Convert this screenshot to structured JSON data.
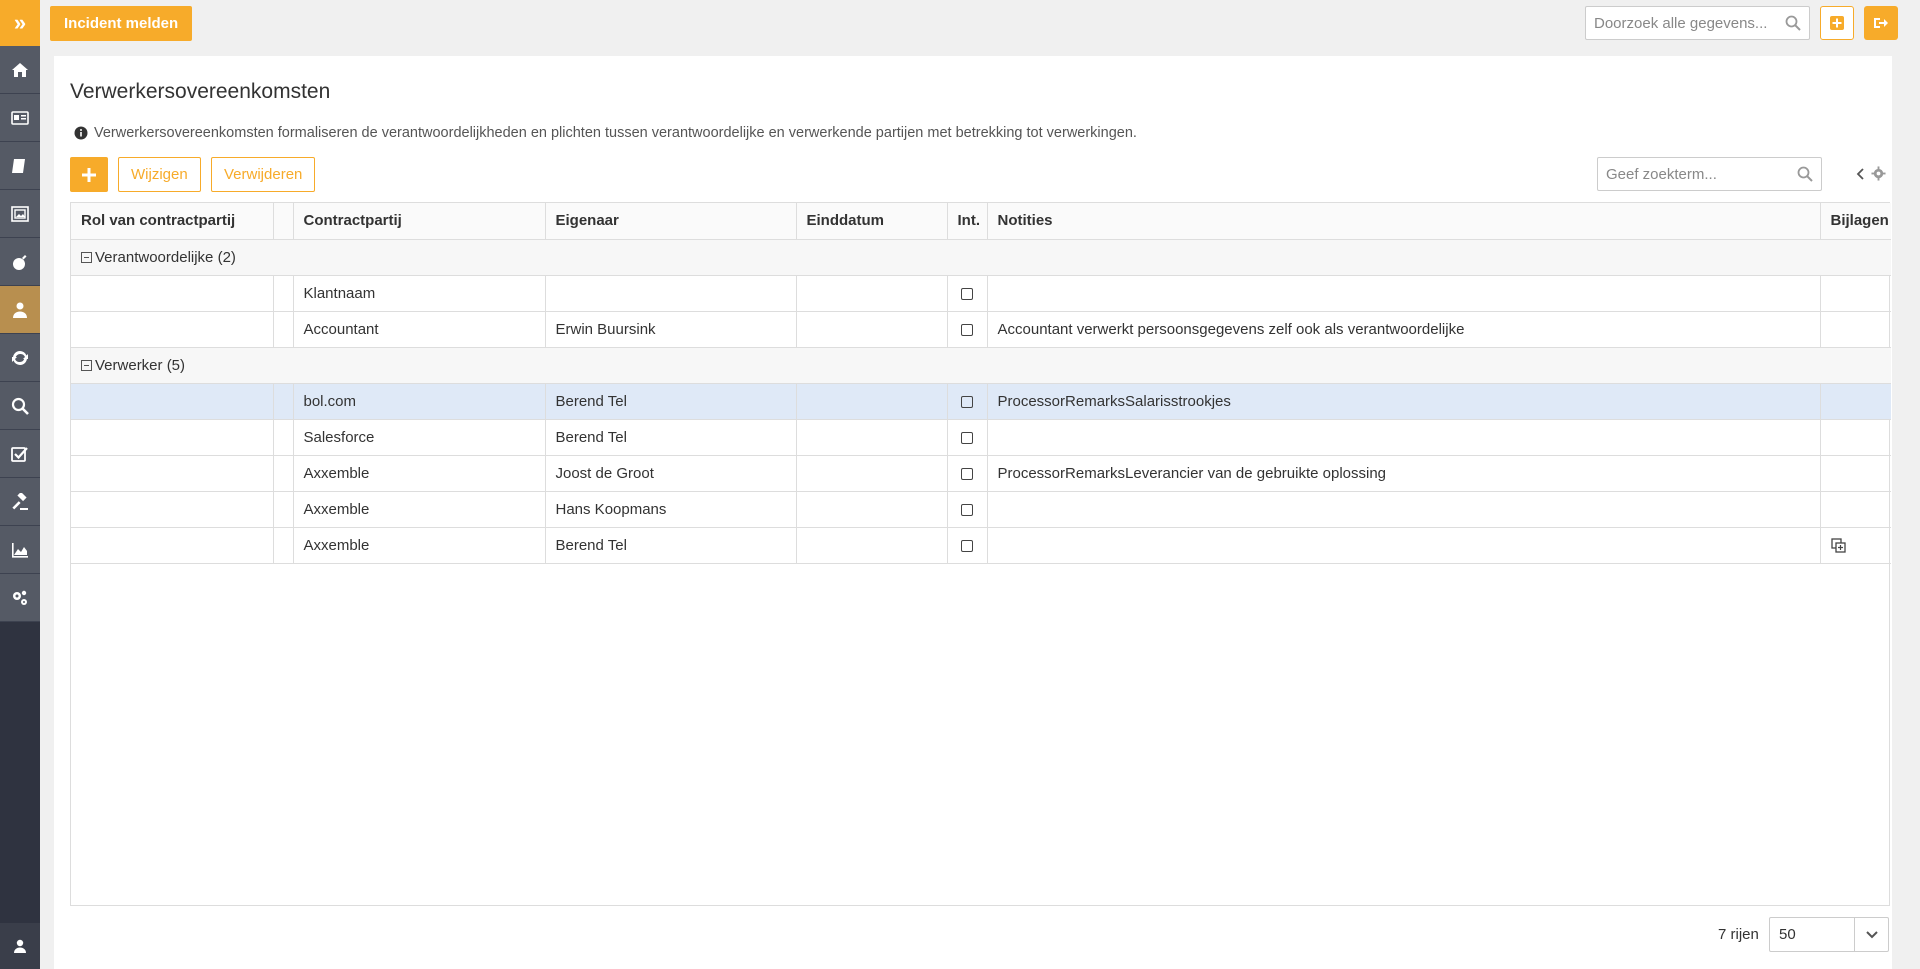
{
  "sidebar": {
    "toggle_glyph": "»",
    "items": [
      {
        "icon": "home-icon"
      },
      {
        "icon": "id-card-icon"
      },
      {
        "icon": "book-icon"
      },
      {
        "icon": "picture-frame-icon"
      },
      {
        "icon": "bomb-icon"
      },
      {
        "icon": "user-icon",
        "active": true
      },
      {
        "icon": "refresh-icon"
      },
      {
        "icon": "search-icon"
      },
      {
        "icon": "checkbox-icon"
      },
      {
        "icon": "gavel-icon"
      },
      {
        "icon": "area-chart-icon"
      },
      {
        "icon": "cogs-icon"
      }
    ],
    "bottom_icon": "user-icon"
  },
  "topbar": {
    "incident_label": "Incident melden",
    "search_placeholder": "Doorzoek alle gegevens..."
  },
  "page": {
    "title": "Verwerkersovereenkomsten",
    "info": "Verwerkersovereenkomsten formaliseren de verantwoordelijkheden en plichten tussen verantwoordelijke en verwerkende partijen met betrekking tot verwerkingen."
  },
  "toolbar": {
    "edit_label": "Wijzigen",
    "delete_label": "Verwijderen",
    "search_placeholder": "Geef zoekterm..."
  },
  "table": {
    "columns": [
      "Rol van contractpartij",
      "",
      "Contractpartij",
      "Eigenaar",
      "Einddatum",
      "Int.",
      "Notities",
      "Bijlagen"
    ],
    "groups": [
      {
        "label": "Verantwoordelijke (2)",
        "rows": [
          {
            "party": "Klantnaam",
            "owner": "",
            "end": "",
            "notes": "",
            "attachment": false
          },
          {
            "party": "Accountant",
            "owner": "Erwin Buursink",
            "end": "",
            "notes": "Accountant verwerkt persoonsgegevens zelf ook als verantwoordelijke",
            "attachment": false
          }
        ]
      },
      {
        "label": "Verwerker (5)",
        "rows": [
          {
            "party": "bol.com",
            "owner": "Berend Tel",
            "end": "",
            "notes": "ProcessorRemarksSalarisstrookjes",
            "attachment": false,
            "selected": true
          },
          {
            "party": "Salesforce",
            "owner": "Berend Tel",
            "end": "",
            "notes": "",
            "attachment": false
          },
          {
            "party": "Axxemble",
            "owner": "Joost de Groot",
            "end": "",
            "notes": "ProcessorRemarksLeverancier van de gebruikte oplossing",
            "attachment": false
          },
          {
            "party": "Axxemble",
            "owner": "Hans Koopmans",
            "end": "",
            "notes": "",
            "attachment": false
          },
          {
            "party": "Axxemble",
            "owner": "Berend Tel",
            "end": "",
            "notes": "",
            "attachment": true
          }
        ]
      }
    ]
  },
  "footer": {
    "row_count": "7 rijen",
    "page_size": "50"
  },
  "colors": {
    "accent": "#f7ab2a",
    "sidebar": "#2f3340",
    "sidebar_active": "#b88f4f",
    "selected_row": "#dfe9f7"
  }
}
